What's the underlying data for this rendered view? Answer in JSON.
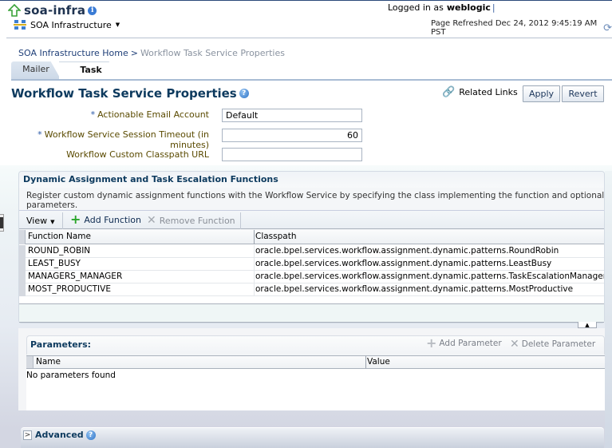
{
  "header": {
    "app_title": "soa-infra",
    "target_menu_label": "SOA Infrastructure",
    "logged_in_prefix": "Logged in as",
    "username": "weblogic",
    "page_refreshed": "Page Refreshed Dec 24, 2012 9:45:19 AM PST"
  },
  "breadcrumb": {
    "home_link": "SOA Infrastructure Home",
    "separator": ">",
    "current": "Workflow Task Service Properties"
  },
  "tabs": [
    {
      "label": "Mailer",
      "selected": false
    },
    {
      "label": "Task",
      "selected": true
    }
  ],
  "page": {
    "title": "Workflow Task Service Properties",
    "related_links_label": "Related Links",
    "apply_label": "Apply",
    "revert_label": "Revert"
  },
  "form": {
    "fields": [
      {
        "label": "Actionable Email Account",
        "required": true,
        "value": "Default"
      },
      {
        "label": "Workflow Service Session Timeout (in minutes)",
        "required": true,
        "value": "60"
      },
      {
        "label": "Workflow Custom Classpath URL",
        "required": false,
        "value": ""
      }
    ],
    "required_marker": "*"
  },
  "dynamic_functions": {
    "title": "Dynamic Assignment and Task Escalation Functions",
    "description": "Register custom dynamic assignment functions with the Workflow Service by specifying the class implementing the function and optional parameters.",
    "toolbar": {
      "view_label": "View",
      "add_label": "Add Function",
      "remove_label": "Remove Function"
    },
    "columns": [
      "Function Name",
      "Classpath"
    ],
    "rows": [
      {
        "name": "ROUND_ROBIN",
        "classpath": "oracle.bpel.services.workflow.assignment.dynamic.patterns.RoundRobin"
      },
      {
        "name": "LEAST_BUSY",
        "classpath": "oracle.bpel.services.workflow.assignment.dynamic.patterns.LeastBusy"
      },
      {
        "name": "MANAGERS_MANAGER",
        "classpath": "oracle.bpel.services.workflow.assignment.dynamic.patterns.TaskEscalationManagersManager"
      },
      {
        "name": "MOST_PRODUCTIVE",
        "classpath": "oracle.bpel.services.workflow.assignment.dynamic.patterns.MostProductive"
      }
    ]
  },
  "parameters": {
    "title": "Parameters:",
    "add_label": "Add Parameter",
    "delete_label": "Delete Parameter",
    "columns": [
      "Name",
      "Value"
    ],
    "empty_text": "No parameters found"
  },
  "advanced": {
    "label": "Advanced"
  },
  "icons": {
    "info": "i",
    "help": "?",
    "caret": "▼",
    "refresh": "⟳",
    "link": "🔗",
    "plus": "+",
    "x": "✕",
    "expand": ">",
    "splitter": "▲"
  },
  "colors": {
    "heading": "#0d3a5e",
    "link": "#1f3f78",
    "label": "#5a4a00",
    "add_icon": "#2aa52a"
  }
}
